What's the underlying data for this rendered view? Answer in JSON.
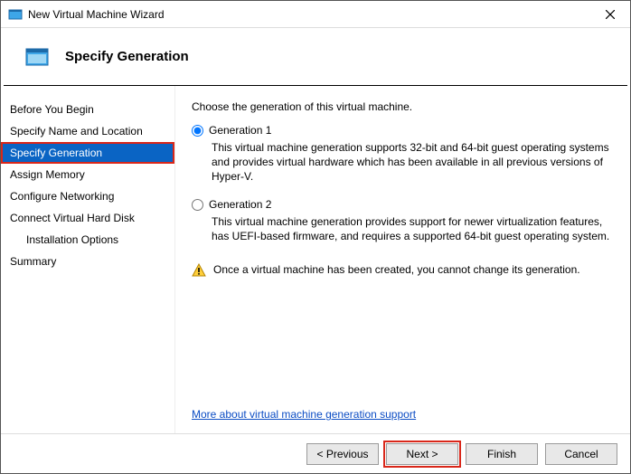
{
  "titlebar": {
    "title": "New Virtual Machine Wizard"
  },
  "header": {
    "title": "Specify Generation"
  },
  "sidebar": {
    "items": [
      {
        "label": "Before You Begin",
        "indent": false
      },
      {
        "label": "Specify Name and Location",
        "indent": false
      },
      {
        "label": "Specify Generation",
        "indent": false,
        "selected": true
      },
      {
        "label": "Assign Memory",
        "indent": false
      },
      {
        "label": "Configure Networking",
        "indent": false
      },
      {
        "label": "Connect Virtual Hard Disk",
        "indent": false
      },
      {
        "label": "Installation Options",
        "indent": true
      },
      {
        "label": "Summary",
        "indent": false
      }
    ]
  },
  "content": {
    "intro": "Choose the generation of this virtual machine.",
    "options": [
      {
        "label": "Generation 1",
        "checked": true,
        "desc": "This virtual machine generation supports 32-bit and 64-bit guest operating systems and provides virtual hardware which has been available in all previous versions of Hyper-V."
      },
      {
        "label": "Generation 2",
        "checked": false,
        "desc": "This virtual machine generation provides support for newer virtualization features, has UEFI-based firmware, and requires a supported 64-bit guest operating system."
      }
    ],
    "warning": "Once a virtual machine has been created, you cannot change its generation.",
    "link": "More about virtual machine generation support"
  },
  "footer": {
    "previous": "< Previous",
    "next": "Next >",
    "finish": "Finish",
    "cancel": "Cancel"
  }
}
